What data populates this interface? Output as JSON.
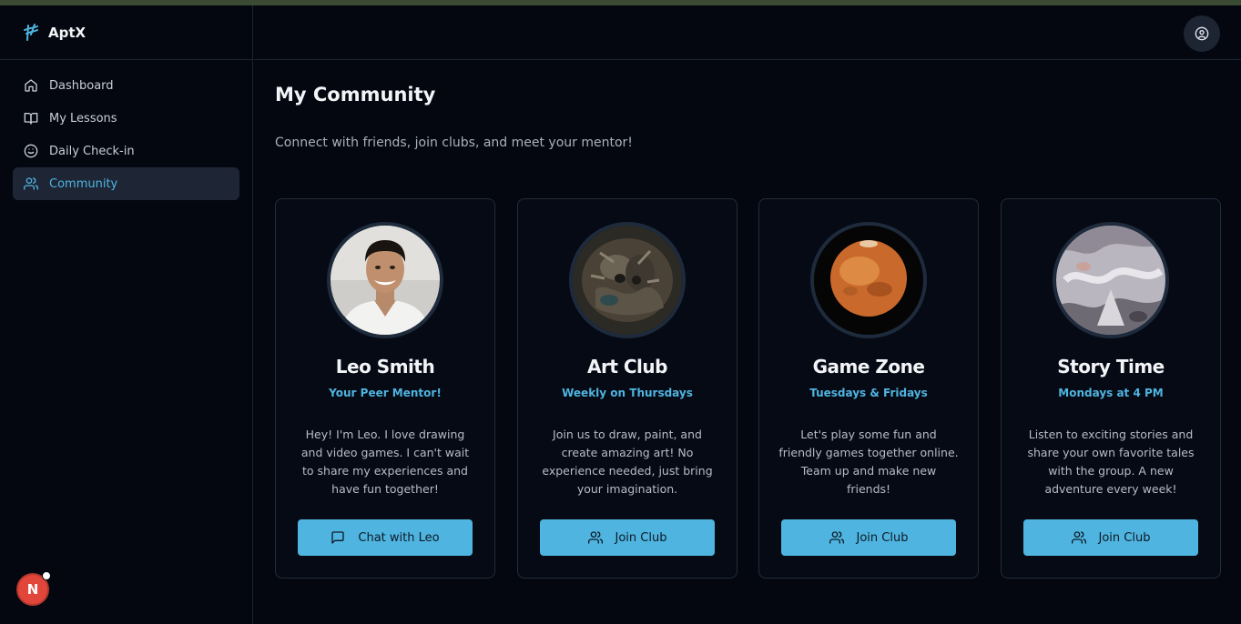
{
  "app": {
    "name": "AptX"
  },
  "sidebar": {
    "items": [
      {
        "label": "Dashboard",
        "icon": "home-icon",
        "active": false
      },
      {
        "label": "My Lessons",
        "icon": "book-icon",
        "active": false
      },
      {
        "label": "Daily Check-in",
        "icon": "smile-icon",
        "active": false
      },
      {
        "label": "Community",
        "icon": "users-icon",
        "active": true
      }
    ],
    "user_initial": "N"
  },
  "header": {
    "profile_icon": "user-circle-icon"
  },
  "page": {
    "title": "My Community",
    "subtitle": "Connect with friends, join clubs, and meet your mentor!"
  },
  "cards": [
    {
      "name": "Leo Smith",
      "subtitle": "Your Peer Mentor!",
      "description": "Hey! I'm Leo. I love drawing and video games. I can't wait to share my experiences and have fun together!",
      "button": "Chat with Leo",
      "button_icon": "chat-icon"
    },
    {
      "name": "Art Club",
      "subtitle": "Weekly on Thursdays",
      "description": "Join us to draw, paint, and create amazing art! No experience needed, just bring your imagination.",
      "button": "Join Club",
      "button_icon": "users-icon"
    },
    {
      "name": "Game Zone",
      "subtitle": "Tuesdays & Fridays",
      "description": "Let's play some fun and friendly games together online. Team up and make new friends!",
      "button": "Join Club",
      "button_icon": "users-icon"
    },
    {
      "name": "Story Time",
      "subtitle": "Mondays at 4 PM",
      "description": "Listen to exciting stories and share your own favorite tales with the group. A new adventure every week!",
      "button": "Join Club",
      "button_icon": "users-icon"
    }
  ],
  "colors": {
    "accent": "#4fb4df",
    "background": "#04070f",
    "avatar": "#e2463b"
  }
}
